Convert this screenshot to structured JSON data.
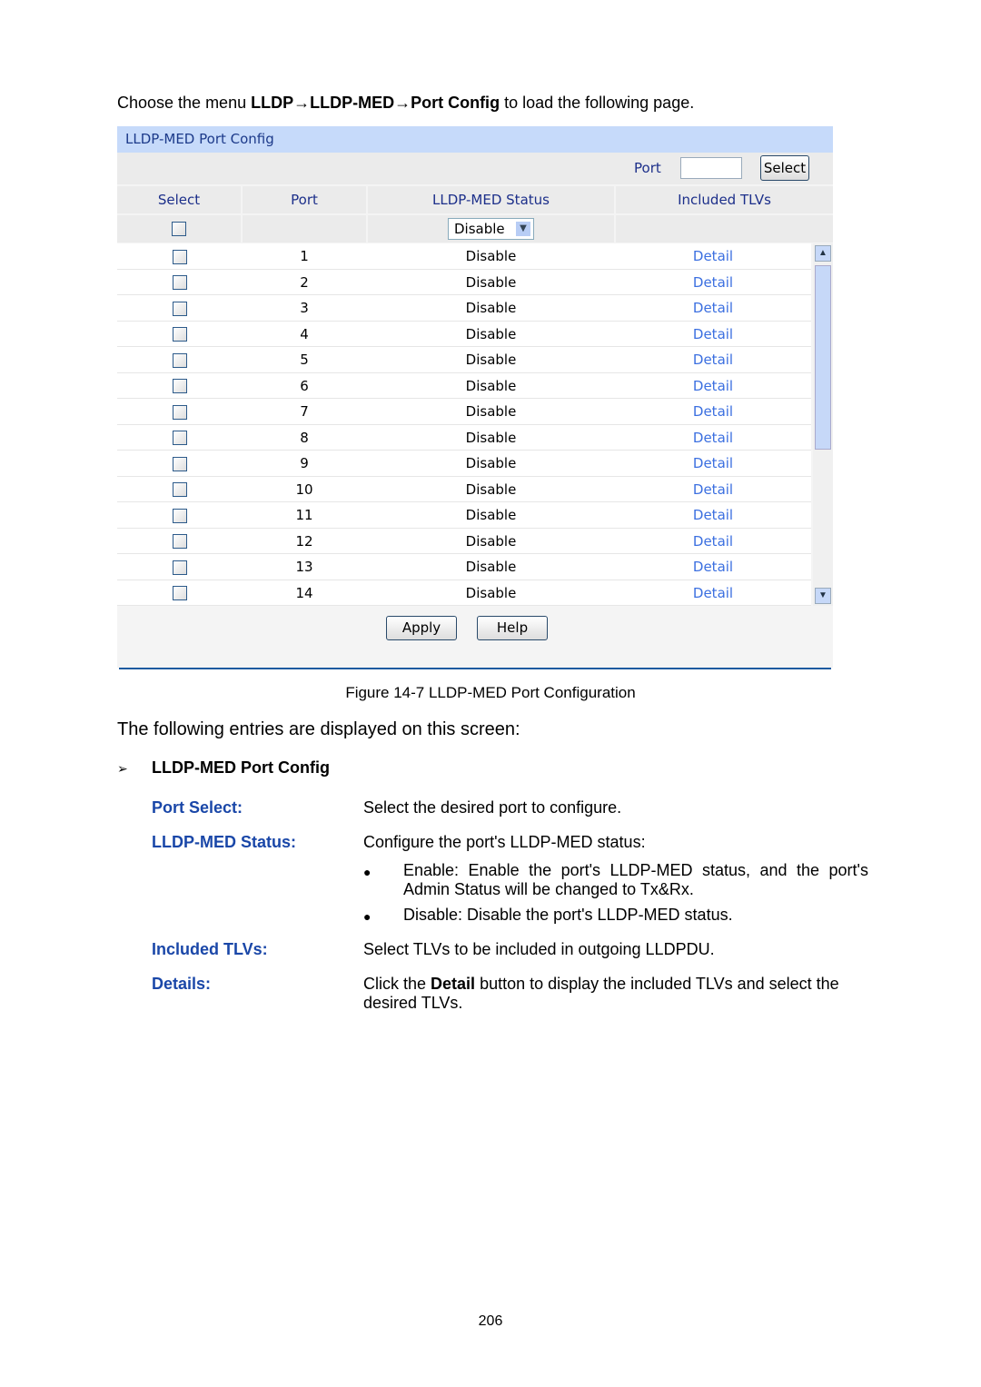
{
  "intro": {
    "prefix": "Choose the menu ",
    "path": "LLDP→LLDP-MED→Port Config",
    "suffix": " to load the following page."
  },
  "panel": {
    "title": "LLDP-MED Port Config",
    "port_label": "Port",
    "port_value": "",
    "select_button": "Select",
    "headers": [
      "Select",
      "Port",
      "LLDP-MED Status",
      "Included TLVs"
    ],
    "filter_status": "Disable",
    "rows": [
      {
        "port": "1",
        "status": "Disable",
        "tlv": "Detail"
      },
      {
        "port": "2",
        "status": "Disable",
        "tlv": "Detail"
      },
      {
        "port": "3",
        "status": "Disable",
        "tlv": "Detail"
      },
      {
        "port": "4",
        "status": "Disable",
        "tlv": "Detail"
      },
      {
        "port": "5",
        "status": "Disable",
        "tlv": "Detail"
      },
      {
        "port": "6",
        "status": "Disable",
        "tlv": "Detail"
      },
      {
        "port": "7",
        "status": "Disable",
        "tlv": "Detail"
      },
      {
        "port": "8",
        "status": "Disable",
        "tlv": "Detail"
      },
      {
        "port": "9",
        "status": "Disable",
        "tlv": "Detail"
      },
      {
        "port": "10",
        "status": "Disable",
        "tlv": "Detail"
      },
      {
        "port": "11",
        "status": "Disable",
        "tlv": "Detail"
      },
      {
        "port": "12",
        "status": "Disable",
        "tlv": "Detail"
      },
      {
        "port": "13",
        "status": "Disable",
        "tlv": "Detail"
      },
      {
        "port": "14",
        "status": "Disable",
        "tlv": "Detail"
      }
    ],
    "apply": "Apply",
    "help": "Help"
  },
  "caption": "Figure 14-7 LLDP-MED Port Configuration",
  "subtitle": "The following entries are displayed on this screen:",
  "section": "LLDP-MED Port Config",
  "entries": [
    {
      "term": "Port Select:",
      "desc": "Select the desired port to configure."
    },
    {
      "term": "LLDP-MED Status:",
      "desc": "Configure the port's LLDP-MED status:",
      "bullets": [
        "Enable: Enable the port's LLDP-MED status, and the port's Admin Status will be changed to Tx&Rx.",
        "Disable: Disable the port's LLDP-MED status."
      ]
    },
    {
      "term": "Included TLVs:",
      "desc": "Select TLVs to be included in outgoing LLDPDU."
    },
    {
      "term": "Details:",
      "desc_prefix": "Click the ",
      "desc_bold": "Detail",
      "desc_suffix": " button to display the included TLVs and select the desired TLVs."
    }
  ],
  "page_number": "206"
}
